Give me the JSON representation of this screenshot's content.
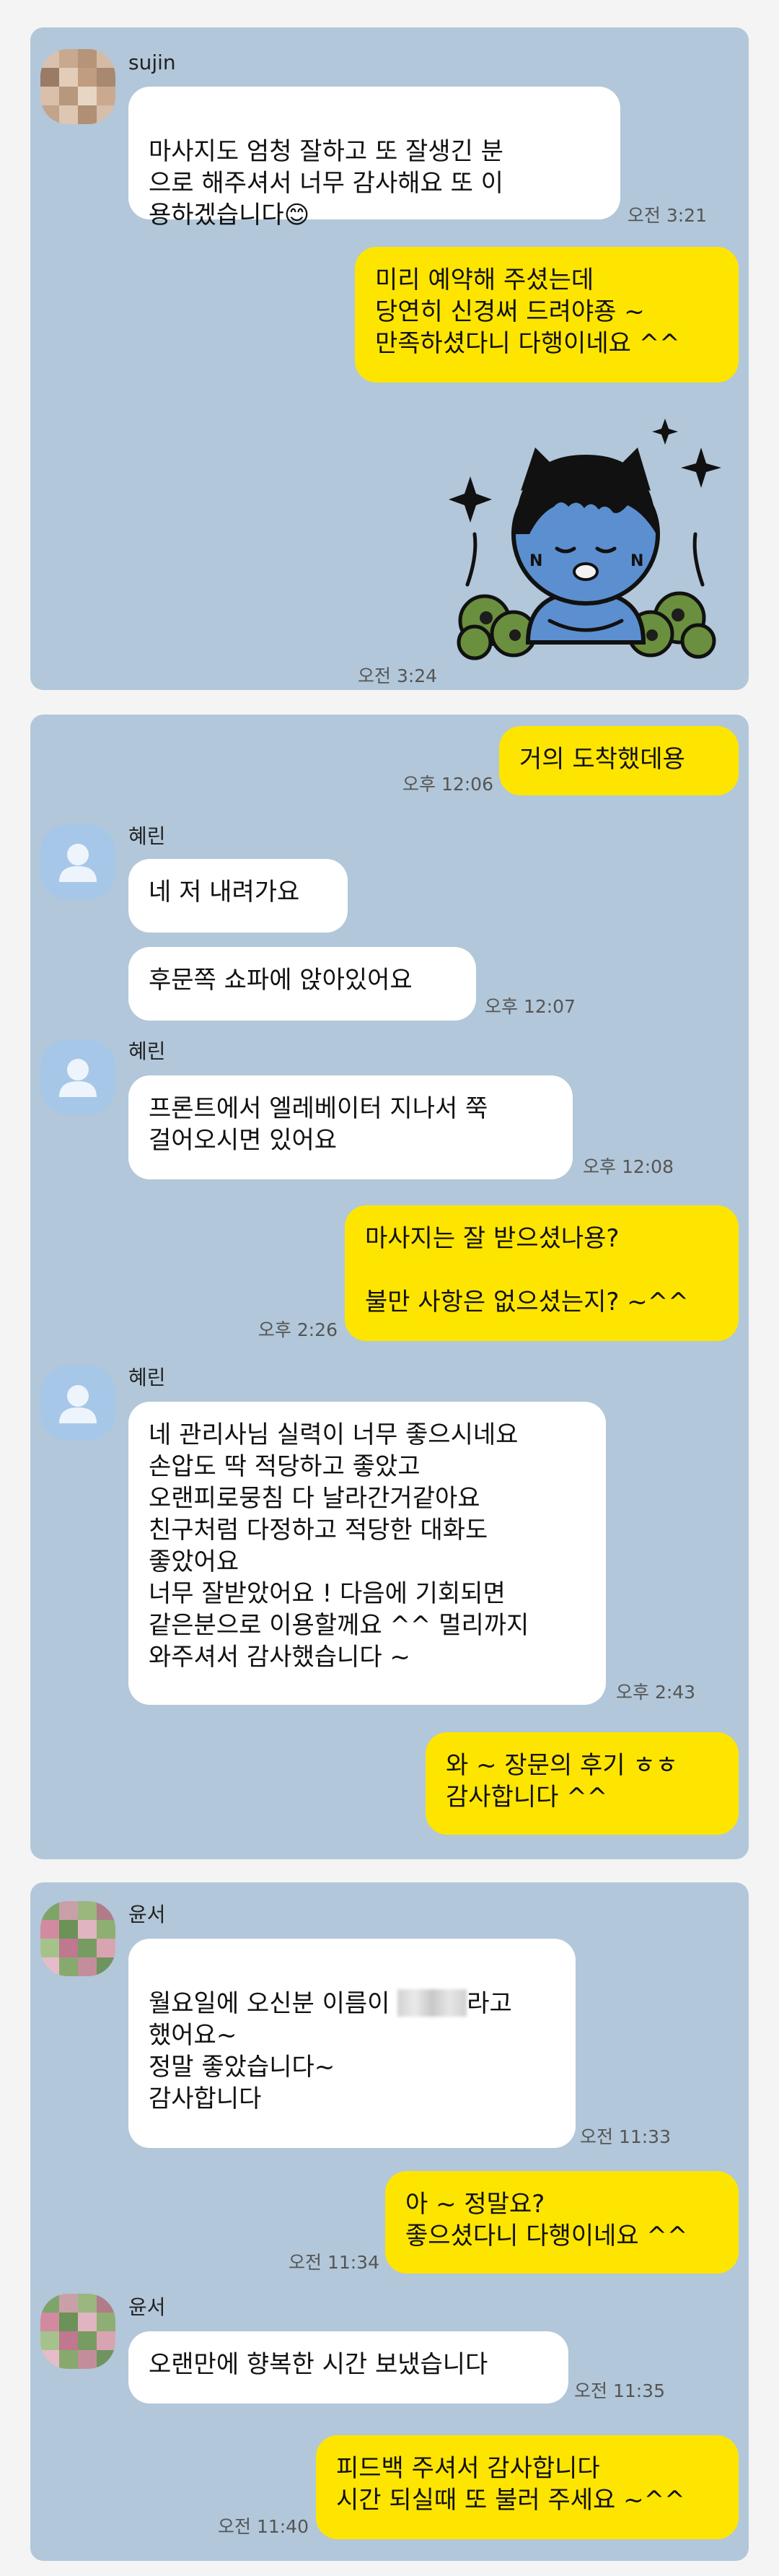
{
  "chat1": {
    "sender": "sujin",
    "msg1": "마사지도 엄청 잘하고 또 잘생긴 분\n으로 해주셔서 너무 감사해요 또 이\n용하겠습니다",
    "emoji": "😊",
    "time1": "오전 3:21",
    "reply1": "미리 예약해 주셨는데\n당연히 신경써 드려야죵 ~\n만족하셨다니 다행이네요 ^^",
    "time2": "오전 3:24"
  },
  "chat2": {
    "sent1": "거의 도착했데용",
    "time_sent1": "오후 12:06",
    "sender": "혜린",
    "msg1": "네 저 내려가요",
    "msg2": "후문쪽 쇼파에 앉아있어요",
    "time_msg2": "오후 12:07",
    "msg3": "프론트에서 엘레베이터 지나서 쭉\n걸어오시면 있어요",
    "time_msg3": "오후 12:08",
    "sent2": "마사지는 잘 받으셨나용?\n\n불만 사항은 없으셨는지? ~^^",
    "time_sent2": "오후 2:26",
    "msg4": "네 관리사님 실력이 너무 좋으시네요\n손압도 딱 적당하고 좋았고\n오랜피로뭉침 다 날라간거같아요\n친구처럼 다정하고 적당한 대화도\n좋았어요\n너무 잘받았어요 ! 다음에 기회되면\n같은분으로 이용할께요 ^^ 멀리까지\n와주셔서 감사했습니다 ~",
    "time_msg4": "오후 2:43",
    "sent3": "와 ~ 장문의 후기 ㅎㅎ\n감사합니다 ^^"
  },
  "chat3": {
    "sender": "윤서",
    "msg1_a": "월요일에 오신분 이름이 ",
    "msg1_b": "라고\n했어요~\n정말 좋았습니다~\n감사합니다",
    "time_msg1": "오전 11:33",
    "sent1": "아 ~ 정말요?\n좋으셨다니 다행이네요 ^^",
    "time_sent1": "오전 11:34",
    "msg2": "오랜만에 향복한 시간 보냈습니다",
    "time_msg2": "오전 11:35",
    "sent2": "피드백 주셔서 감사합니다\n시간 되실때 또 불러 주세요 ~^^",
    "time_sent2": "오전 11:40"
  },
  "colors": {
    "chat_bg": "#b2c7d9",
    "my_bubble": "#fee500",
    "their_bubble": "#ffffff",
    "default_avatar": "#a6c7e8"
  }
}
